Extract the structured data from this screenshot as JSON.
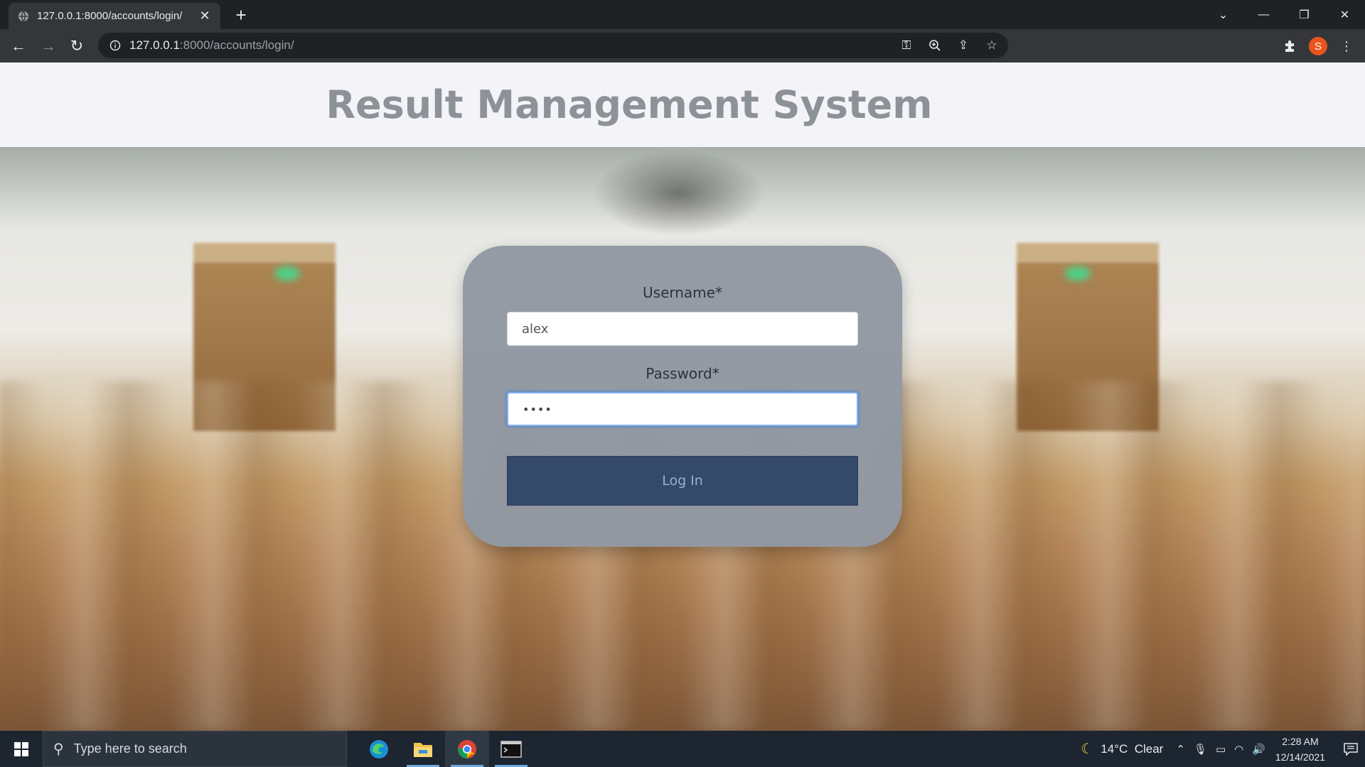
{
  "browser": {
    "tab_title": "127.0.0.1:8000/accounts/login/",
    "url_host": "127.0.0.1",
    "url_path": ":8000/accounts/login/",
    "profile_initial": "S"
  },
  "page": {
    "title": "Result Management System",
    "username_label": "Username*",
    "username_value": "alex",
    "password_label": "Password*",
    "password_value": "••••",
    "login_label": "Log In"
  },
  "taskbar": {
    "search_placeholder": "Type here to search",
    "weather": "14°C  Clear",
    "time": "2:28 AM",
    "date": "12/14/2021"
  },
  "colors": {
    "card": "#9198a2",
    "button": "#35496a",
    "title": "#8d9299"
  }
}
